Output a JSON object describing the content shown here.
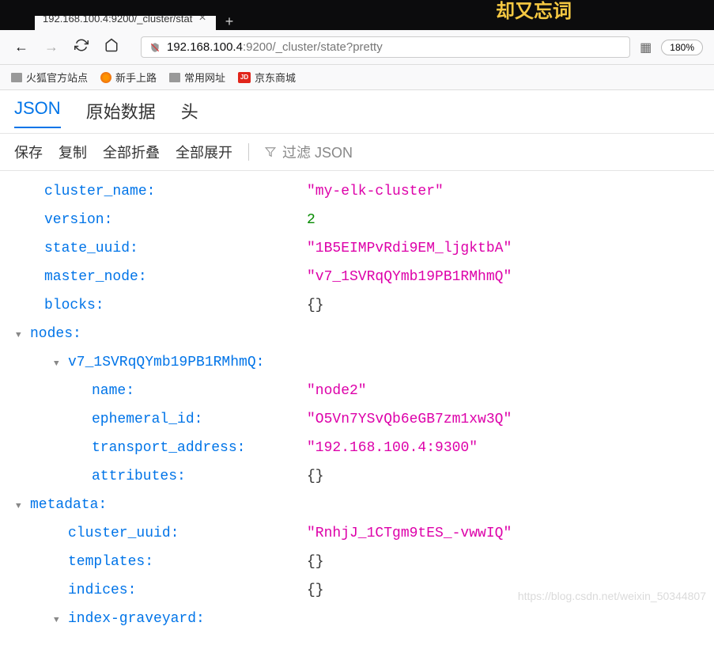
{
  "overlay_text": "却又忘词",
  "tab": {
    "title": "192.168.100.4:9200/_cluster/stat",
    "close": "×",
    "new": "+"
  },
  "nav": {
    "back": "←",
    "forward": "→",
    "reload": "⟳",
    "home": "⌂",
    "url_host": "192.168.100.4",
    "url_rest": ":9200/_cluster/state?pretty",
    "zoom": "180%"
  },
  "bookmarks": [
    {
      "label": "火狐官方站点",
      "icon": "folder"
    },
    {
      "label": "新手上路",
      "icon": "firefox"
    },
    {
      "label": "常用网址",
      "icon": "folder"
    },
    {
      "label": "京东商城",
      "icon": "jd",
      "badge": "JD"
    }
  ],
  "view_tabs": {
    "json": "JSON",
    "raw": "原始数据",
    "headers": "头"
  },
  "toolbar": {
    "save": "保存",
    "copy": "复制",
    "collapse_all": "全部折叠",
    "expand_all": "全部展开",
    "filter_placeholder": "过滤 JSON"
  },
  "json": {
    "cluster_name": {
      "key": "cluster_name:",
      "value": "\"my-elk-cluster\""
    },
    "version": {
      "key": "version:",
      "value": "2"
    },
    "state_uuid": {
      "key": "state_uuid:",
      "value": "\"1B5EIMPvRdi9EM_ljgktbA\""
    },
    "master_node": {
      "key": "master_node:",
      "value": "\"v7_1SVRqQYmb19PB1RMhmQ\""
    },
    "blocks": {
      "key": "blocks:",
      "value": "{}"
    },
    "nodes": {
      "key": "nodes:"
    },
    "node_id": {
      "key": "v7_1SVRqQYmb19PB1RMhmQ:"
    },
    "node_name": {
      "key": "name:",
      "value": "\"node2\""
    },
    "ephemeral_id": {
      "key": "ephemeral_id:",
      "value": "\"O5Vn7YSvQb6eGB7zm1xw3Q\""
    },
    "transport_address": {
      "key": "transport_address:",
      "value": "\"192.168.100.4:9300\""
    },
    "attributes": {
      "key": "attributes:",
      "value": "{}"
    },
    "metadata": {
      "key": "metadata:"
    },
    "cluster_uuid": {
      "key": "cluster_uuid:",
      "value": "\"RnhjJ_1CTgm9tES_-vwwIQ\""
    },
    "templates": {
      "key": "templates:",
      "value": "{}"
    },
    "indices": {
      "key": "indices:",
      "value": "{}"
    },
    "index_graveyard": {
      "key": "index-graveyard:"
    }
  },
  "watermark": "https://blog.csdn.net/weixin_50344807"
}
